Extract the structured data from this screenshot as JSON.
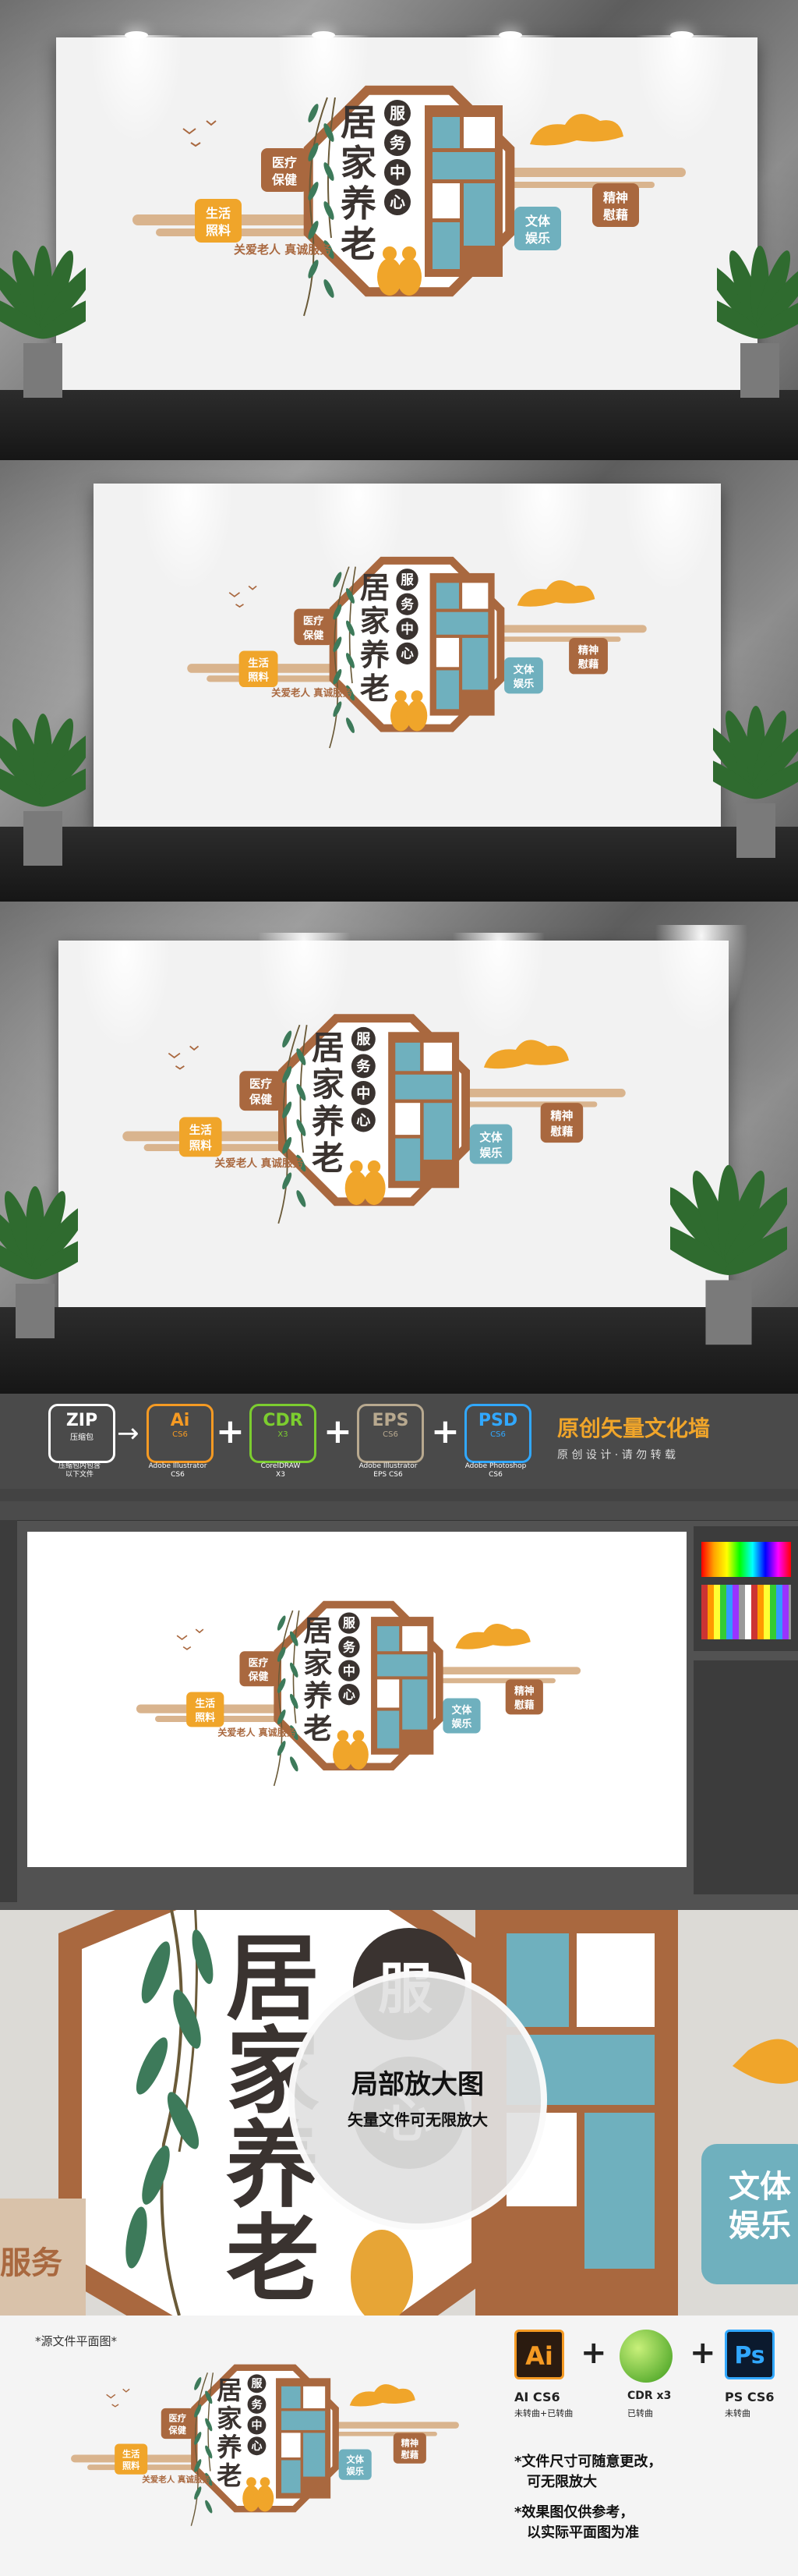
{
  "sign": {
    "title_main": [
      "居",
      "家",
      "养",
      "老"
    ],
    "title_sub": [
      "服",
      "务",
      "中",
      "心"
    ],
    "badges": {
      "life": [
        "生活",
        "照料"
      ],
      "medical": [
        "医疗",
        "保健"
      ],
      "entertainment": [
        "文体",
        "娱乐"
      ],
      "spirit": [
        "精神",
        "慰藉"
      ]
    },
    "slogan": "关爱老人  真诚服务"
  },
  "formats": {
    "zip": {
      "name": "ZIP",
      "sub": "压缩包",
      "caption": [
        "压缩包内包含",
        "以下文件"
      ]
    },
    "ai": {
      "name": "Ai",
      "sub": "CS6",
      "caption": [
        "Adobe Illustrator",
        "CS6"
      ]
    },
    "cdr": {
      "name": "CDR",
      "sub": "X3",
      "caption": [
        "CorelDRAW",
        "X3"
      ]
    },
    "eps": {
      "name": "EPS",
      "sub": "CS6",
      "caption": [
        "Adobe Illustrator",
        "EPS CS6"
      ]
    },
    "psd": {
      "name": "PSD",
      "sub": "CS6",
      "caption": [
        "Adobe Photoshop",
        "CS6"
      ]
    },
    "brand_title": "原创矢量文化墙",
    "brand_sub": "原 创 设 计 · 请 勿 转 载"
  },
  "zoom": {
    "title": "局部放大图",
    "subtitle": "矢量文件可无限放大",
    "bg_chars": [
      "居",
      "家",
      "养",
      "老"
    ],
    "bg_sub": [
      "服",
      "务",
      "心"
    ],
    "bg_badge": [
      "文体",
      "娱乐"
    ],
    "bg_slogan": "服务"
  },
  "source": {
    "label": "*源文件平面图*",
    "ai_label": "AI CS6",
    "ai_note": "未转曲+已转曲",
    "cdr_label": "CDR x3",
    "cdr_note": "已转曲",
    "ps_label": "PS CS6",
    "ps_note": "未转曲",
    "note1a": "*文件尺寸可随意更改，",
    "note1b": "可无限放大",
    "note2a": "*效果图仅供参考，",
    "note2b": "以实际平面图为准"
  },
  "colors": {
    "brown": "#a9683f",
    "teal": "#6fb0be",
    "orange": "#f0a52a",
    "beige": "#d9b48e",
    "dark": "#3a3330"
  }
}
